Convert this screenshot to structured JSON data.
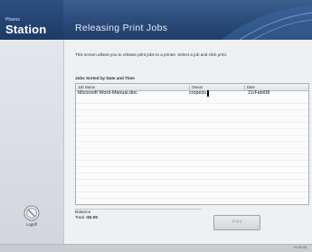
{
  "header": {
    "brand_small": "Pharos",
    "brand_name": "Station",
    "title": "Releasing Print Jobs"
  },
  "main": {
    "description": "This screen allows you to release print jobs to a printer. Select a job and click print.",
    "jobs_label": "Jobs Sorted by Date and Time",
    "table": {
      "columns": [
        "Job Name",
        "Owner",
        "Date"
      ],
      "rows": [
        {
          "job_name": "Micorsoft Word-Manual.doc",
          "owner": "cropezu",
          "date": "21/Feb/08"
        }
      ]
    },
    "balance": {
      "label": "Balance",
      "total_label": "Total",
      "total_value": "-$0.00"
    },
    "print_label": "Print"
  },
  "sidebar": {
    "logoff_label": "Logoff",
    "logoff_icon": "logoff-icon"
  },
  "status": {
    "text": "04.06.08"
  },
  "colors": {
    "header": "#2a4a78",
    "brand": "#1e3a66",
    "content_bg": "#eef0f2"
  }
}
